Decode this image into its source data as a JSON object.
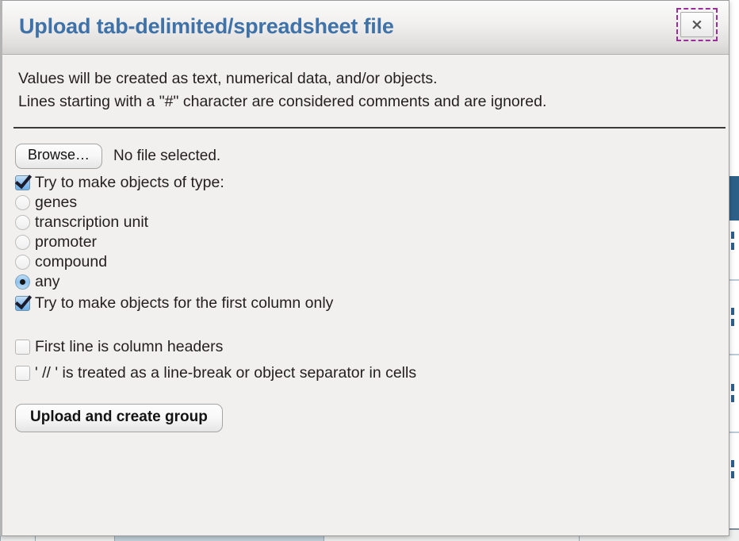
{
  "dialog": {
    "title": "Upload tab-delimited/spreadsheet file",
    "close_label": "×",
    "description_line_1": "Values will be created as text, numerical data, and/or objects.",
    "description_line_2": "Lines starting with a \"#\" character are considered comments and are ignored."
  },
  "file_picker": {
    "browse_label": "Browse…",
    "status_text": "No file selected."
  },
  "object_type": {
    "enable_label": "Try to make objects of type:",
    "enabled": true,
    "options": [
      {
        "label": "genes",
        "selected": false
      },
      {
        "label": "transcription unit",
        "selected": false
      },
      {
        "label": "promoter",
        "selected": false
      },
      {
        "label": "compound",
        "selected": false
      },
      {
        "label": "any",
        "selected": true
      }
    ],
    "first_column_only_label": "Try to make objects for the first column only",
    "first_column_only_checked": true
  },
  "parsing_options": [
    {
      "label": "First line is column headers",
      "checked": false
    },
    {
      "label": "' // ' is treated as a line-break or object separator in cells",
      "checked": false
    }
  ],
  "actions": {
    "submit_label": "Upload and create group"
  },
  "colors": {
    "title_blue": "#3e72a8",
    "focus_outline_purple": "#9b2d9b",
    "control_blue": "#8cc0ee",
    "backdrop_header_blue": "#2d6089"
  }
}
